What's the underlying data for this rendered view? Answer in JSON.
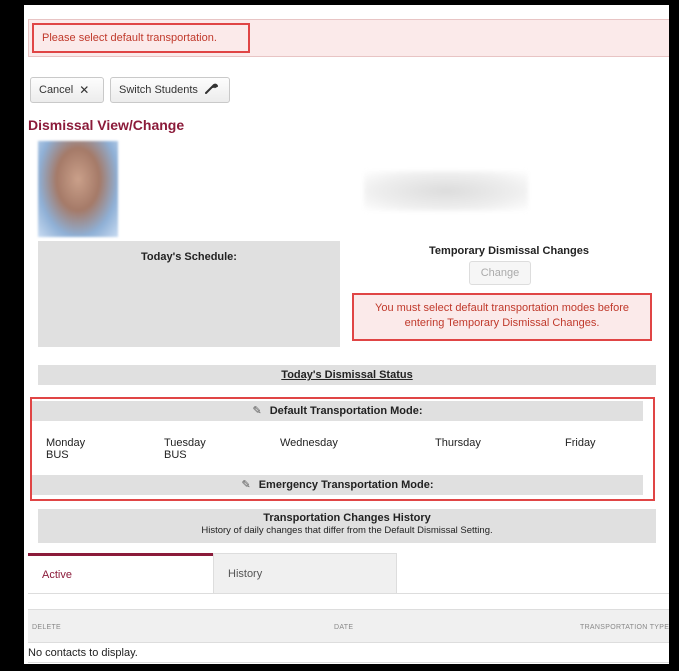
{
  "alert": {
    "message": "Please select default transportation."
  },
  "toolbar": {
    "cancel_label": "Cancel",
    "switch_label": "Switch Students"
  },
  "page": {
    "title": "Dismissal View/Change"
  },
  "schedule": {
    "title": "Today's Schedule:"
  },
  "temporary": {
    "title": "Temporary Dismissal Changes",
    "change_label": "Change",
    "warning_line1": "You must select default transportation modes before",
    "warning_line2": "entering Temporary Dismissal Changes."
  },
  "status": {
    "title": "Today's Dismissal Status"
  },
  "default_mode": {
    "title": "Default Transportation Mode:",
    "days": [
      {
        "name": "Monday",
        "mode": "BUS"
      },
      {
        "name": "Tuesday",
        "mode": "BUS"
      },
      {
        "name": "Wednesday",
        "mode": ""
      },
      {
        "name": "Thursday",
        "mode": ""
      },
      {
        "name": "Friday",
        "mode": ""
      }
    ]
  },
  "emergency_mode": {
    "title": "Emergency Transportation Mode:"
  },
  "history": {
    "title": "Transportation Changes History",
    "subtitle": "History of daily changes that differ from the Default Dismissal Setting."
  },
  "tabs": [
    {
      "label": "Active"
    },
    {
      "label": "History"
    }
  ],
  "table": {
    "columns": [
      "DELETE",
      "DATE",
      "TRANSPORTATION TYPE"
    ],
    "empty_message": "No contacts to display."
  },
  "colors": {
    "accent": "#8b1b3a",
    "alert_red": "#e04545",
    "alert_bg": "#fbeaea"
  },
  "icons": {
    "cancel": "close-icon",
    "switch": "wrench-icon",
    "edit": "pencil-icon"
  }
}
